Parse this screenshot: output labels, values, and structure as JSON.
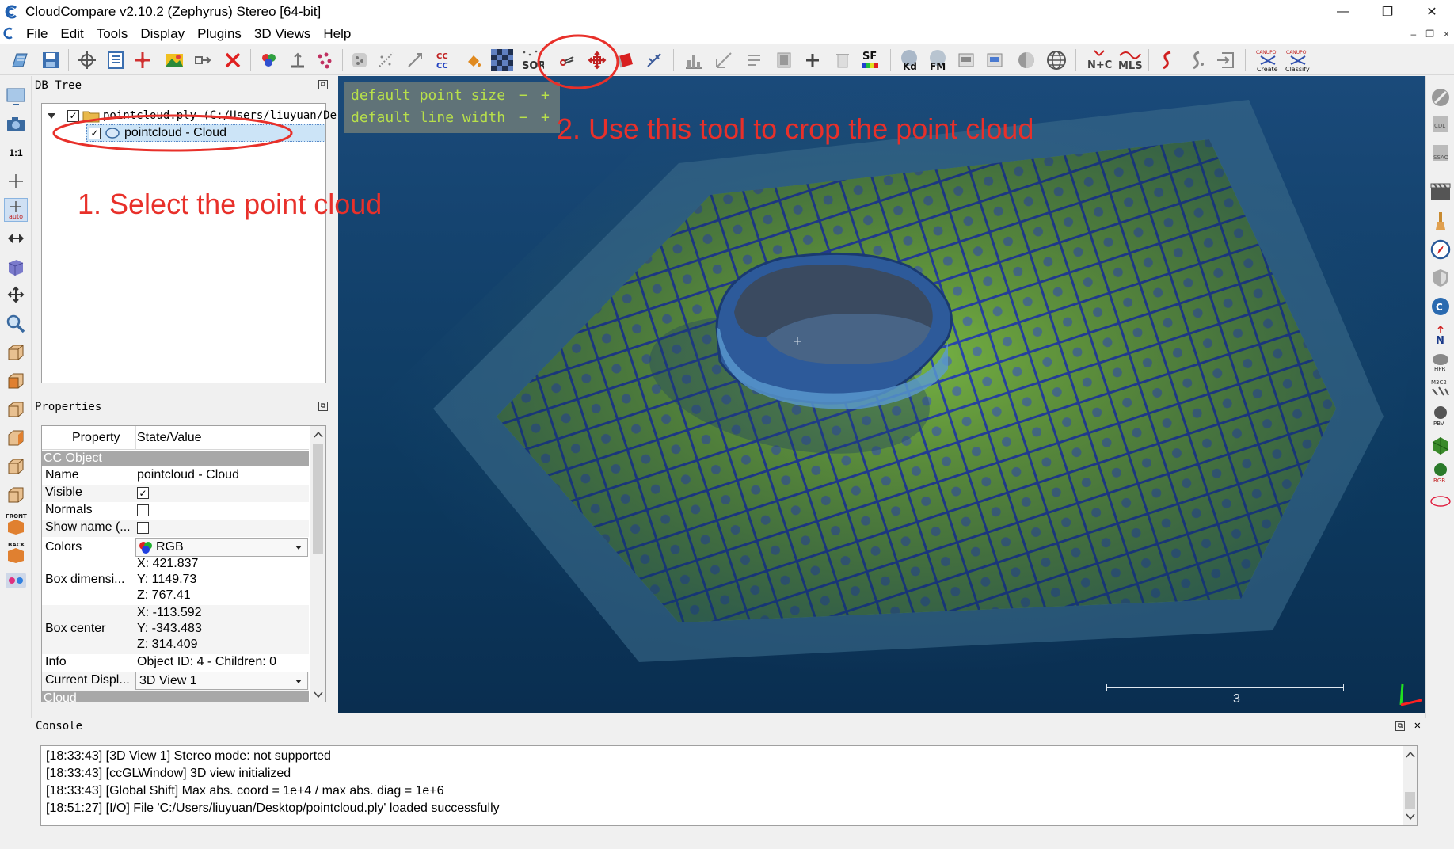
{
  "window": {
    "title": "CloudCompare v2.10.2 (Zephyrus) Stereo [64-bit]",
    "minimize": "—",
    "maximize": "❐",
    "close": "✕"
  },
  "menu": {
    "items": [
      "File",
      "Edit",
      "Tools",
      "Display",
      "Plugins",
      "3D Views",
      "Help"
    ],
    "mdi": [
      "–",
      "❐",
      "×"
    ]
  },
  "toolbar": {
    "labels": {
      "cc": "CC\nCC",
      "sor": "SOR",
      "sf": "SF",
      "kd": "Kd",
      "fm": "FM",
      "nc": "N+C",
      "mls": "MLS",
      "canupo_create": "CANUPO\nCreate",
      "canupo_classify": "CANUPO\nClassify"
    }
  },
  "left_toolbar": {
    "labels": {
      "one_to_one": "1:1",
      "auto": "auto",
      "front": "FRONT",
      "back": "BACK"
    }
  },
  "right_toolbar": {
    "labels": {
      "n": "N",
      "hpr": "HPR",
      "m3c2": "M3C2",
      "pbv": "PBV",
      "rgb": "RGB"
    }
  },
  "db_tree": {
    "title": "DB Tree",
    "root": {
      "label": "pointcloud.ply (C:/Users/liuyuan/De",
      "checked": true
    },
    "child": {
      "label": "pointcloud - Cloud",
      "checked": true,
      "selected": true
    }
  },
  "properties": {
    "title": "Properties",
    "col_property": "Property",
    "col_value": "State/Value",
    "section": "CC Object",
    "rows": {
      "name": {
        "label": "Name",
        "value": "pointcloud - Cloud"
      },
      "visible": {
        "label": "Visible",
        "checked": true
      },
      "normals": {
        "label": "Normals",
        "checked": false
      },
      "showname": {
        "label": "Show name (...",
        "checked": false
      },
      "colors": {
        "label": "Colors",
        "value": "RGB"
      },
      "boxdim": {
        "label": "Box dimensi...",
        "x": "X: 421.837",
        "y": "Y: 1149.73",
        "z": "Z: 767.41"
      },
      "boxcenter": {
        "label": "Box center",
        "x": "X: -113.592",
        "y": "Y: -343.483",
        "z": "Z: 314.409"
      },
      "info": {
        "label": "Info",
        "value": "Object ID: 4 - Children: 0"
      },
      "currentdisplay": {
        "label": "Current Displ...",
        "value": "3D View 1"
      },
      "next_section": "Cloud"
    }
  },
  "view3d": {
    "overlay": {
      "point_size": "default point size",
      "line_width": "default line width",
      "minus": "−",
      "plus": "+"
    },
    "scale_label": "3"
  },
  "annotations": {
    "step1": "1. Select the point cloud",
    "step2": "2. Use this tool to crop the point cloud",
    "color": "#e8302a"
  },
  "console": {
    "title": "Console",
    "lines": [
      "[18:33:43] [3D View 1] Stereo mode: not supported",
      "[18:33:43] [ccGLWindow] 3D view initialized",
      "[18:33:43] [Global Shift] Max abs. coord = 1e+4 / max abs. diag = 1e+6",
      "[18:51:27] [I/O] File 'C:/Users/liuyuan/Desktop/pointcloud.ply' loaded successfully"
    ]
  }
}
